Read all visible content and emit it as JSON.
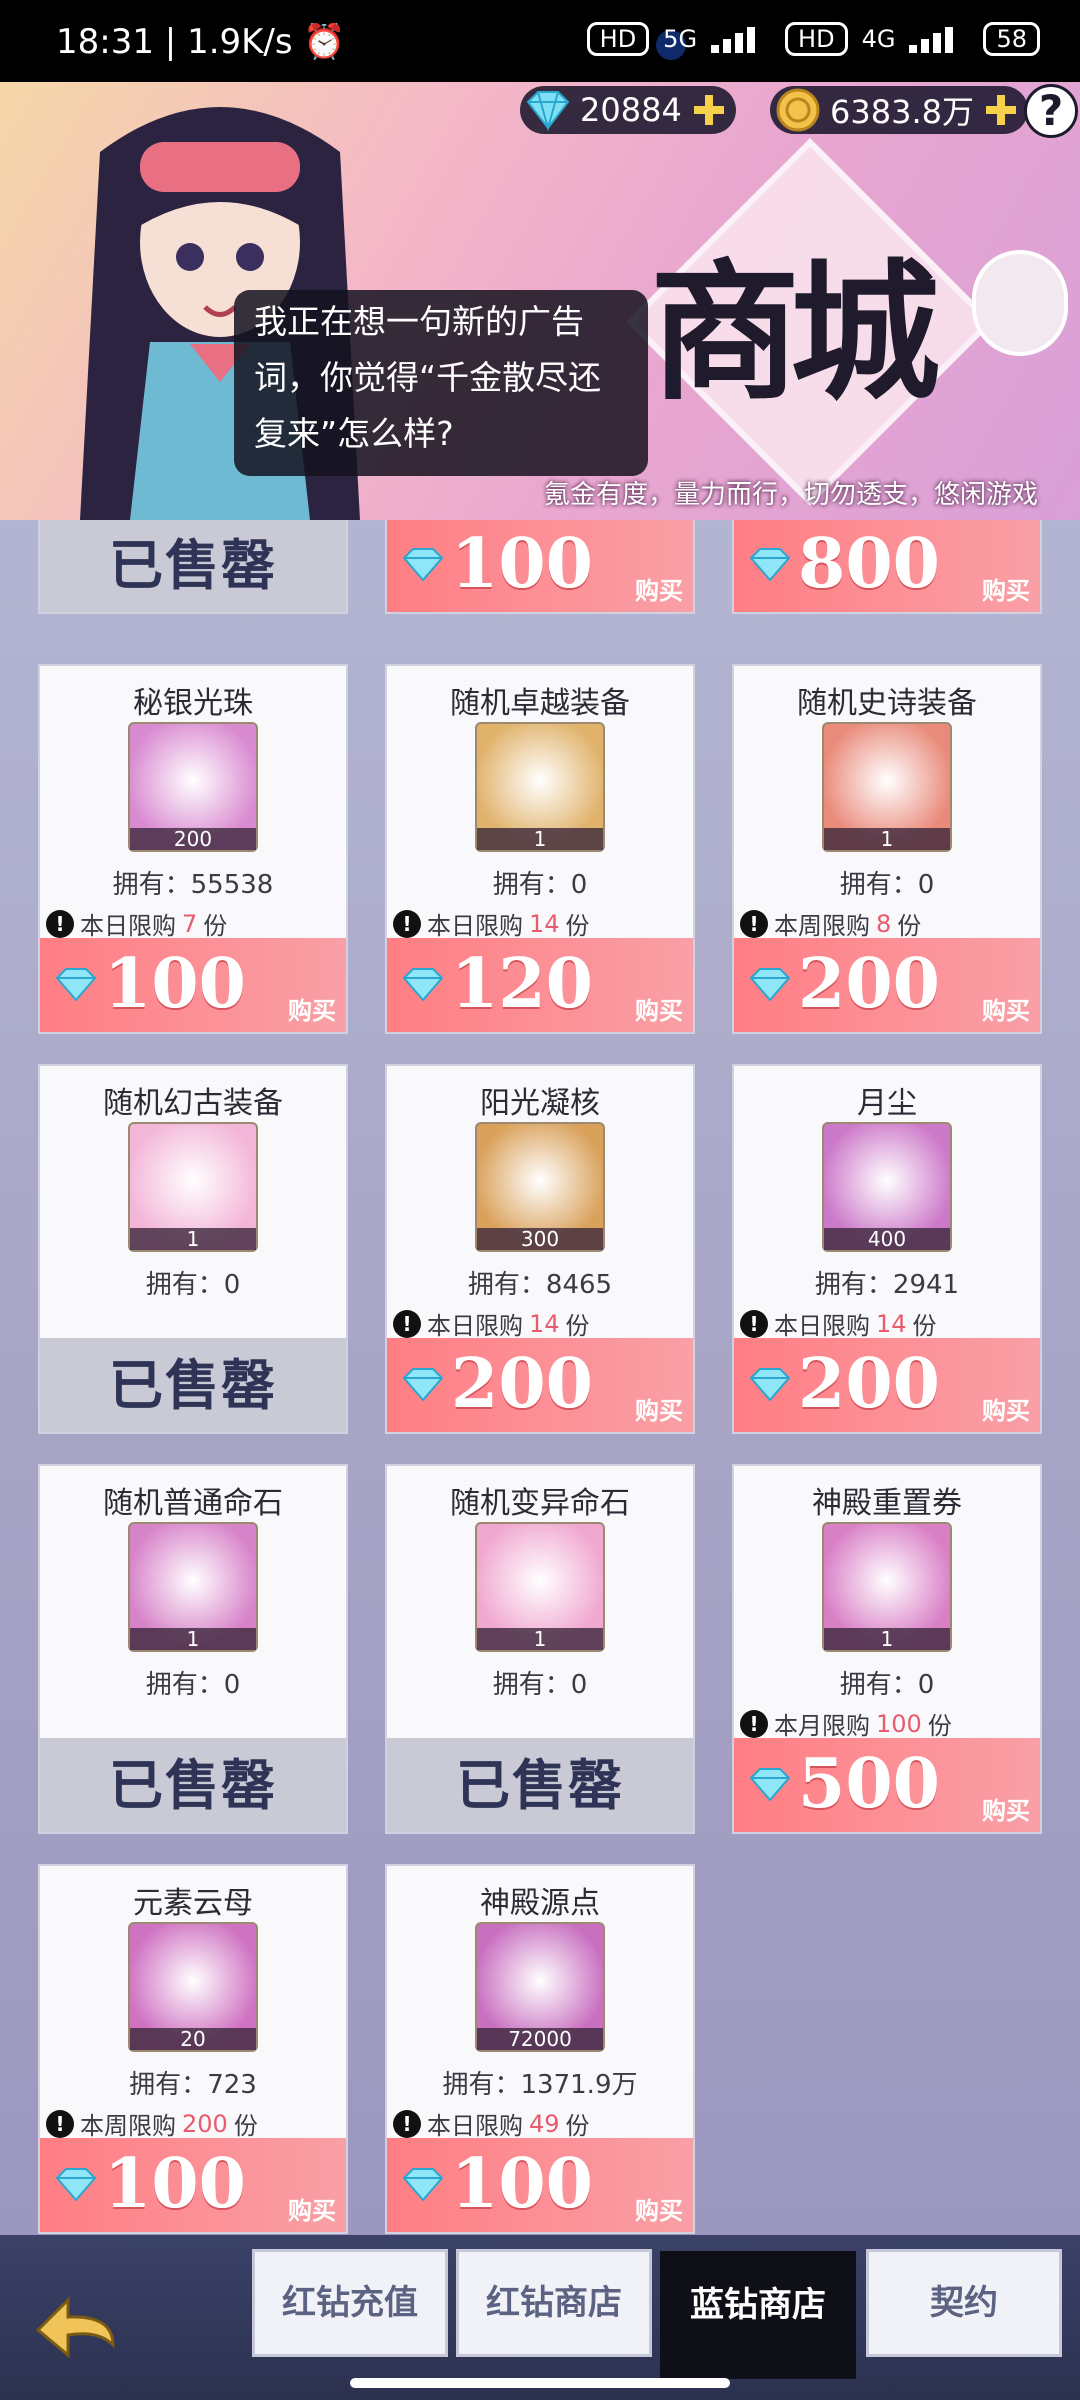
{
  "status_bar": {
    "time": "18:31",
    "speed": "1.9K/s",
    "net1": "5G",
    "net2": "4G",
    "battery": "58"
  },
  "header": {
    "diamonds": "20884",
    "coins": "6383.8万",
    "help": "?",
    "title": "商城",
    "speech": "我正在想一句新的广告词，你觉得“千金散尽还复来”怎么样?",
    "tagline": "氪金有度，量力而行，切勿透支，悠闲游戏"
  },
  "labels": {
    "owned_prefix": "拥有：",
    "buy": "购买",
    "sold_out": "已售罄",
    "unit": "份"
  },
  "partial_row": [
    {
      "state": "sold"
    },
    {
      "state": "buy",
      "price": "100"
    },
    {
      "state": "buy",
      "price": "800"
    }
  ],
  "items": [
    {
      "name": "秘银光珠",
      "qty": "200",
      "owned": "55538",
      "limit_label": "本日限购",
      "limit": "7",
      "state": "buy",
      "price": "100",
      "icon": "silver-orb-icon",
      "color": "#d98bd1"
    },
    {
      "name": "随机卓越装备",
      "qty": "1",
      "owned": "0",
      "limit_label": "本日限购",
      "limit": "14",
      "state": "buy",
      "price": "120",
      "icon": "treasure-chest-icon",
      "color": "#e0b26a"
    },
    {
      "name": "随机史诗装备",
      "qty": "1",
      "owned": "0",
      "limit_label": "本周限购",
      "limit": "8",
      "state": "buy",
      "price": "200",
      "icon": "epic-chest-icon",
      "color": "#e98a7a"
    },
    {
      "name": "随机幻古装备",
      "qty": "1",
      "owned": "0",
      "limit_label": "",
      "limit": "",
      "state": "sold",
      "price": "",
      "icon": "ancient-chest-icon",
      "color": "#f3b6d8"
    },
    {
      "name": "阳光凝核",
      "qty": "300",
      "owned": "8465",
      "limit_label": "本日限购",
      "limit": "14",
      "state": "buy",
      "price": "200",
      "icon": "sun-core-icon",
      "color": "#d9a15a"
    },
    {
      "name": "月尘",
      "qty": "400",
      "owned": "2941",
      "limit_label": "本日限购",
      "limit": "14",
      "state": "buy",
      "price": "200",
      "icon": "moon-dust-icon",
      "color": "#cc79c9"
    },
    {
      "name": "随机普通命石",
      "qty": "1",
      "owned": "0",
      "limit_label": "",
      "limit": "",
      "state": "sold",
      "price": "",
      "icon": "fate-stone-icon",
      "color": "#d783c9"
    },
    {
      "name": "随机变异命石",
      "qty": "1",
      "owned": "0",
      "limit_label": "",
      "limit": "",
      "state": "sold",
      "price": "",
      "icon": "mutant-stone-icon",
      "color": "#f0a7d0"
    },
    {
      "name": "神殿重置券",
      "qty": "1",
      "owned": "0",
      "limit_label": "本月限购",
      "limit": "100",
      "state": "buy",
      "price": "500",
      "icon": "temple-ticket-icon",
      "color": "#d97fc6"
    },
    {
      "name": "元素云母",
      "qty": "20",
      "owned": "723",
      "limit_label": "本周限购",
      "limit": "200",
      "state": "buy",
      "price": "100",
      "icon": "element-mica-icon",
      "color": "#cf72c2"
    },
    {
      "name": "神殿源点",
      "qty": "72000",
      "owned": "1371.9万",
      "limit_label": "本日限购",
      "limit": "49",
      "state": "buy",
      "price": "100",
      "icon": "temple-origin-icon",
      "color": "#c86fc0"
    }
  ],
  "nav": {
    "tabs": [
      "红钻充值",
      "红钻商店",
      "蓝钻商店",
      "契约"
    ],
    "active": 2
  }
}
